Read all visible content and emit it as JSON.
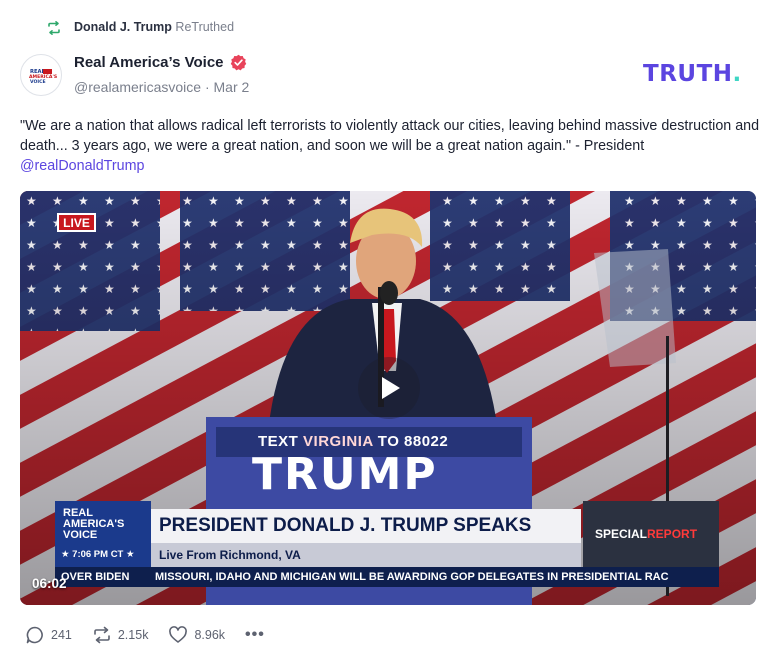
{
  "retruth": {
    "icon": "retruth-icon",
    "name": "Donald J. Trump",
    "label": "ReTruthed"
  },
  "author": {
    "avatar_icon": "real-americas-voice-logo",
    "avatar_text": "REAL AMERICA'S VOICE",
    "name": "Real America’s Voice",
    "verified_icon": "verified-badge-icon",
    "handle": "@realamericasvoice",
    "separator": "·",
    "date": "Mar 2"
  },
  "brand": {
    "name": "TRUTH",
    "dot": ".",
    "color": "#5b45e0",
    "dot_color": "#3ed6c4"
  },
  "post": {
    "text": "\"We are a nation that allows radical left terrorists to violently attack our cities, leaving behind massive destruction and death... 3 years ago, we were a great nation, and soon we will be a great nation again.\" - President ",
    "mention": "@realDonaldTrump"
  },
  "video": {
    "live_badge": "LIVE",
    "podium_text_prefix": "TEXT ",
    "podium_text_highlight": "VIRGINIA",
    "podium_text_suffix": " TO 88022",
    "podium_big": "TRUMP",
    "lower_third": {
      "logo_text": "REAL AMERICA'S VOICE",
      "time": "★ 7:06 PM CT ★",
      "headline": "PRESIDENT DONALD J. TRUMP SPEAKS",
      "subline": "Live From Richmond, VA",
      "special_prefix": "SPECIAL ",
      "special_suffix": "REPORT"
    },
    "ticker_left": "OVER BIDEN",
    "ticker_right": "MISSOURI, IDAHO AND MICHIGAN WILL BE AWARDING GOP DELEGATES IN PRESIDENTIAL RAC",
    "duration": "06:02",
    "play_icon": "play-icon"
  },
  "actions": {
    "replies": "241",
    "retruths": "2.15k",
    "likes": "8.96k",
    "more": "•••",
    "reply_icon": "reply-icon",
    "retruth_icon": "retruth-icon",
    "like_icon": "heart-icon",
    "more_icon": "more-icon"
  },
  "colors": {
    "accent": "#5b45e0",
    "retruth_green": "#2ea86b",
    "verified_red": "#e8435a"
  }
}
